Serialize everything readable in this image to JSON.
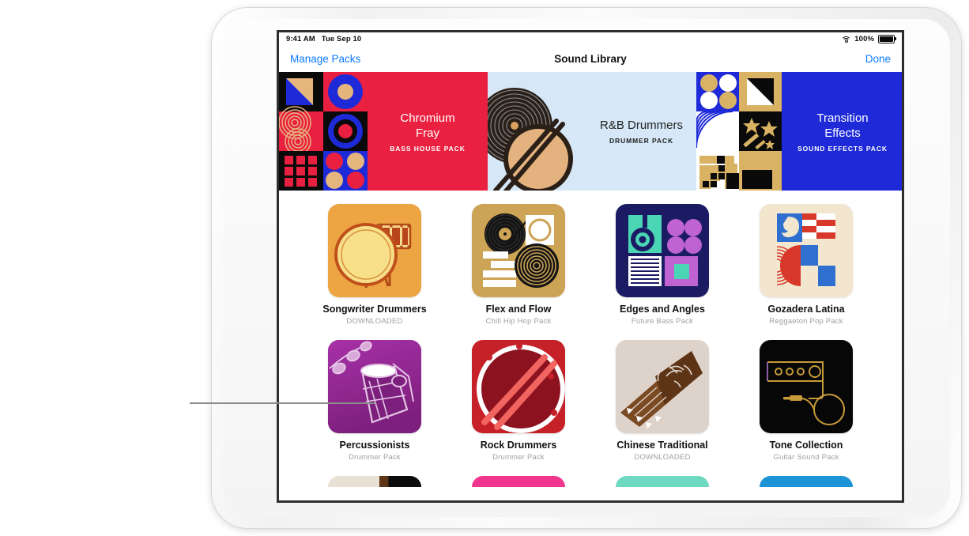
{
  "status_bar": {
    "time": "9:41 AM",
    "date": "Tue Sep 10",
    "wifi_icon": "wifi-icon",
    "battery_percent": "100%",
    "battery_icon": "battery-icon"
  },
  "nav_bar": {
    "left_button": "Manage Packs",
    "title": "Sound Library",
    "right_button": "Done"
  },
  "banners": [
    {
      "title": "Chromium\nFray",
      "title_line1": "Chromium",
      "title_line2": "Fray",
      "subtitle": "BASS HOUSE PACK",
      "bg": "#ea2040",
      "text_color": "#ffffff",
      "art_colors": [
        "#0a0a0a",
        "#1e2ad8",
        "#e5b57e",
        "#ea2040"
      ]
    },
    {
      "title": "R&B Drummers",
      "title_line1": "R&B Drummers",
      "title_line2": "",
      "subtitle": "DRUMMER PACK",
      "bg": "#d6e8f7",
      "text_color": "#222222",
      "art_colors": [
        "#2b2018",
        "#e3b27e"
      ]
    },
    {
      "title": "Transition\nEffects",
      "title_line1": "Transition",
      "title_line2": "Effects",
      "subtitle": "SOUND EFFECTS PACK",
      "bg": "#1e2ad8",
      "text_color": "#ffffff",
      "art_colors": [
        "#d9b264",
        "#0a0a0a",
        "#ffffff",
        "#1e2ad8"
      ]
    }
  ],
  "packs": [
    {
      "name": "Songwriter Drummers",
      "sub": "DOWNLOADED",
      "art_bg": "#eda442",
      "art_kind": "songwriter-drummers-art"
    },
    {
      "name": "Flex and Flow",
      "sub": "Chill Hip Hop Pack",
      "art_bg": "#cda355",
      "art_kind": "flex-and-flow-art"
    },
    {
      "name": "Edges and Angles",
      "sub": "Future Bass Pack",
      "art_bg": "#1b1b63",
      "art_kind": "edges-and-angles-art"
    },
    {
      "name": "Gozadera Latina",
      "sub": "Reggaeton Pop Pack",
      "art_bg": "#f3e6cf",
      "art_kind": "gozadera-latina-art"
    },
    {
      "name": "Percussionists",
      "sub": "Drummer Pack",
      "art_bg": "#9c2a9c",
      "art_kind": "percussionists-art"
    },
    {
      "name": "Rock Drummers",
      "sub": "Drummer Pack",
      "art_bg": "#c62128",
      "art_kind": "rock-drummers-art"
    },
    {
      "name": "Chinese Traditional",
      "sub": "DOWNLOADED",
      "art_bg": "#ded3cb",
      "art_kind": "chinese-traditional-art"
    },
    {
      "name": "Tone Collection",
      "sub": "Guitar Sound Pack",
      "art_bg": "#070707",
      "art_kind": "tone-collection-art"
    }
  ],
  "partial_row_colors": [
    "#e9e0d5",
    "#f0368f",
    "#6ed9c0",
    "#1c94d6"
  ],
  "colors": {
    "accent_blue": "#0a7bff",
    "label": "#111111",
    "sublabel": "#a0a0a0",
    "screen_border": "#2e2e2e",
    "callout_line": "#8b8b8b"
  }
}
